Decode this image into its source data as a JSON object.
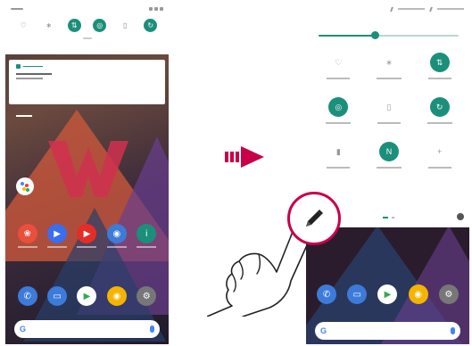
{
  "left_phone": {
    "quick_settings": [
      {
        "icon": "wifi-icon",
        "glyph": "♡",
        "state": "off"
      },
      {
        "icon": "bluetooth-icon",
        "glyph": "∗",
        "state": "off"
      },
      {
        "icon": "data-icon",
        "glyph": "⇅",
        "state": "on"
      },
      {
        "icon": "rotate-icon",
        "glyph": "◎",
        "state": "on"
      },
      {
        "icon": "flashlight-icon",
        "glyph": "▯",
        "state": "off"
      },
      {
        "icon": "sync-icon",
        "glyph": "↻",
        "state": "on"
      }
    ],
    "home_row": [
      {
        "icon": "photos-icon",
        "color": "#e94f3b",
        "glyph": "❀"
      },
      {
        "icon": "duo-icon",
        "color": "#3a6df0",
        "glyph": "▶"
      },
      {
        "icon": "youtube-icon",
        "color": "#e52d27",
        "glyph": "▶"
      },
      {
        "icon": "camera-icon",
        "color": "#3c7bd9",
        "glyph": "◉"
      },
      {
        "icon": "files-icon",
        "color": "#1b8f7a",
        "glyph": "i"
      }
    ],
    "dock": [
      {
        "icon": "phone-icon",
        "color": "#3c7bd9",
        "glyph": "✆"
      },
      {
        "icon": "messages-icon",
        "color": "#3c7bd9",
        "glyph": "▭"
      },
      {
        "icon": "play-store-icon",
        "color": "#ffffff",
        "glyph": "▶"
      },
      {
        "icon": "chrome-icon",
        "color": "#f4b400",
        "glyph": "◉"
      },
      {
        "icon": "settings-icon",
        "color": "#777777",
        "glyph": "⚙"
      }
    ],
    "google_letter": "G"
  },
  "right_phone": {
    "brightness_level": 0.4,
    "tiles": [
      {
        "icon": "wifi-icon",
        "glyph": "♡",
        "state": "off"
      },
      {
        "icon": "bluetooth-icon",
        "glyph": "∗",
        "state": "off"
      },
      {
        "icon": "data-icon",
        "glyph": "⇅",
        "state": "on"
      },
      {
        "icon": "rotate-icon",
        "glyph": "◎",
        "state": "on"
      },
      {
        "icon": "flashlight-icon",
        "glyph": "▯",
        "state": "off"
      },
      {
        "icon": "sync-icon",
        "glyph": "↻",
        "state": "on"
      },
      {
        "icon": "battery-icon",
        "glyph": "▮",
        "state": "off"
      },
      {
        "icon": "nfc-icon",
        "glyph": "N",
        "state": "on"
      },
      {
        "icon": "add-icon",
        "glyph": "+",
        "state": "off"
      }
    ],
    "dock": [
      {
        "icon": "phone-icon",
        "color": "#3c7bd9",
        "glyph": "✆"
      },
      {
        "icon": "messages-icon",
        "color": "#3c7bd9",
        "glyph": "▭"
      },
      {
        "icon": "play-store-icon",
        "color": "#ffffff",
        "glyph": "▶"
      },
      {
        "icon": "chrome-icon",
        "color": "#f4b400",
        "glyph": "◉"
      },
      {
        "icon": "settings-icon",
        "color": "#777777",
        "glyph": "⚙"
      }
    ],
    "google_letter": "G"
  },
  "colors": {
    "accent": "#1b8f7a",
    "callout_ring": "#c8004a",
    "arrow": "#c8004a"
  }
}
